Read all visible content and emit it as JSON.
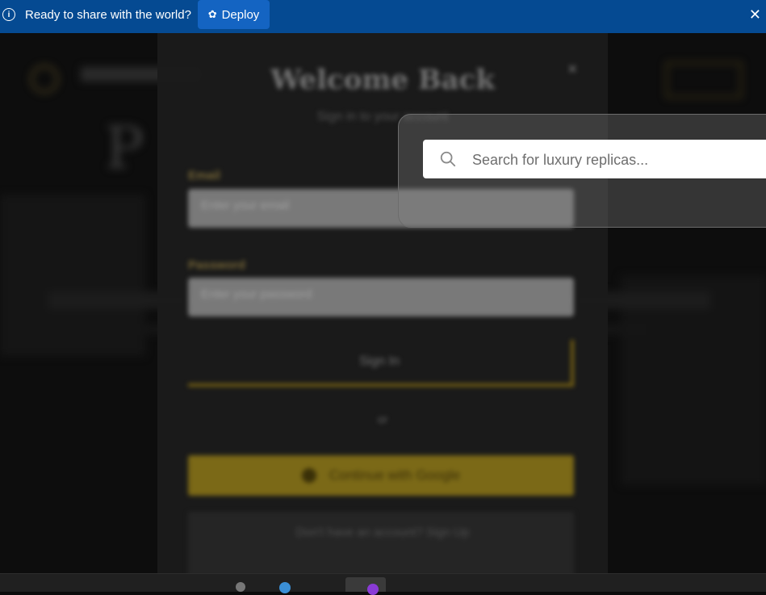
{
  "deploy_bar": {
    "message": "Ready to share with the world?",
    "deploy_label": "Deploy",
    "close_glyph": "✕",
    "icons": [
      "info-icon",
      "deploy-icon",
      "close-icon"
    ]
  },
  "background_page": {
    "hero_title_partial": "P"
  },
  "modal": {
    "title": "Welcome Back",
    "subtitle": "Sign in to your account",
    "close_glyph": "×",
    "email_label": "Email",
    "email_placeholder": "Enter your email",
    "password_label": "Password",
    "password_placeholder": "Enter your password",
    "sign_in_label": "Sign In",
    "or_label": "or",
    "google_label": "Continue with Google",
    "footer_text": "Don't have an account? Sign Up"
  },
  "search": {
    "placeholder": "Search for luxury replicas..."
  },
  "colors": {
    "deploy_bar_bg": "#054a92",
    "deploy_button_bg": "#1464c2",
    "accent_gold": "#7f6c18"
  }
}
